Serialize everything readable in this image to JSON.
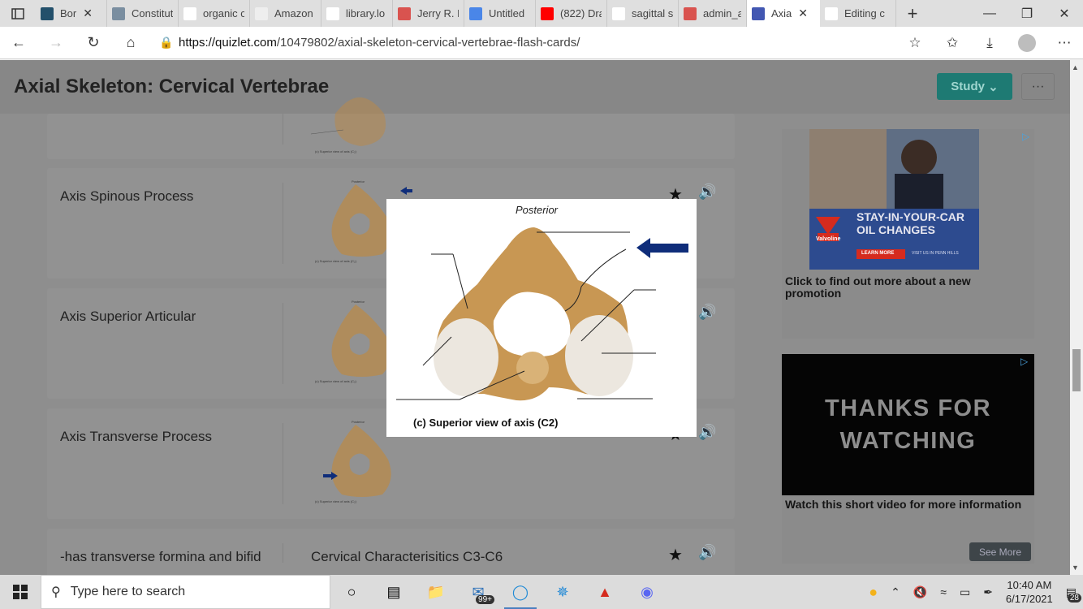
{
  "browser": {
    "tabs": [
      {
        "title": "Bor",
        "favicon": "world-icon",
        "color": "#23506b"
      },
      {
        "title": "Constitut",
        "favicon": "constitution-icon",
        "color": "#7a8ea0"
      },
      {
        "title": "organic c",
        "favicon": "google-icon",
        "color": "#ffffff"
      },
      {
        "title": "Amazon",
        "favicon": "amazon-icon",
        "color": "#eeeeee"
      },
      {
        "title": "library.lo",
        "favicon": "page-icon",
        "color": "#ffffff"
      },
      {
        "title": "Jerry R. N",
        "favicon": "pdf-icon",
        "color": "#d9534f"
      },
      {
        "title": "Untitled",
        "favicon": "docs-icon",
        "color": "#4a86e8"
      },
      {
        "title": "(822) Dra",
        "favicon": "youtube-icon",
        "color": "#ff0000"
      },
      {
        "title": "sagittal s",
        "favicon": "google-icon",
        "color": "#ffffff"
      },
      {
        "title": "admin_a",
        "favicon": "pdf-icon",
        "color": "#d9534f"
      },
      {
        "title": "Axia",
        "favicon": "quizlet-icon",
        "color": "#4257b2"
      },
      {
        "title": "Editing c",
        "favicon": "panda-icon",
        "color": "#ffffff"
      }
    ],
    "url_host": "https://quizlet.com",
    "url_path": "/10479802/axial-skeleton-cervical-vertebrae-flash-cards/"
  },
  "page": {
    "title": "Axial Skeleton: Cervical Vertebrae",
    "study_label": "Study",
    "more_label": "···",
    "thumb_caption": "(c) Superior view of axis (C₂)",
    "thumb_top": "Posterior",
    "cards": [
      {
        "term": "Axis Spinous Process",
        "definition": ""
      },
      {
        "term": "Axis Superior Articular",
        "definition": ""
      },
      {
        "term": "Axis Transverse Process",
        "definition": ""
      },
      {
        "term": "-has transverse formina and bifid",
        "definition": "Cervical Characterisitics C3-C6"
      }
    ]
  },
  "popup": {
    "top_label": "Posterior",
    "caption": "(c) Superior view of axis (C2)"
  },
  "ads": {
    "ad1_headline_1": "STAY-IN-YOUR-CAR",
    "ad1_headline_2": "OIL CHANGES",
    "ad1_brand": "Valvoline",
    "ad1_cta": "LEARN MORE",
    "ad1_sub": "VISIT US IN PENN HILLS",
    "ad1_caption": "Click to find out more about a new promotion",
    "ad2_video_text_1": "THANKS FOR",
    "ad2_video_text_2": "WATCHING",
    "ad2_caption": "Watch this short video for more information",
    "see_more": "See More"
  },
  "taskbar": {
    "search_placeholder": "Type here to search",
    "mail_badge": "99+",
    "time": "10:40 AM",
    "date": "6/17/2021",
    "notif_badge": "28"
  }
}
